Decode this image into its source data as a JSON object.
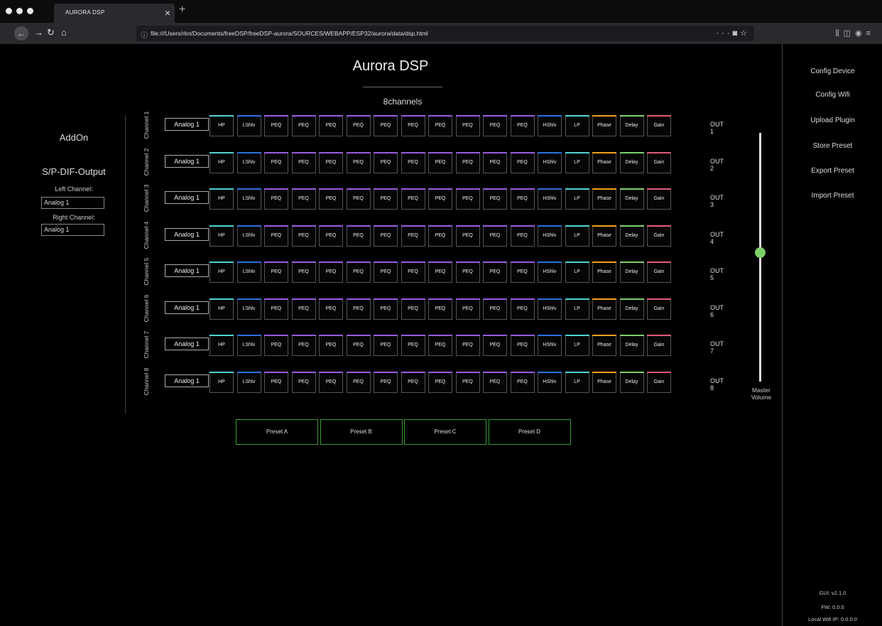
{
  "browser": {
    "tab_title": "AURORA DSP",
    "url": "file:///Users/rkn/Documents/freeDSP/freeDSP-aurora/SOURCES/WEBAPP/ESP32/aurora/data/dsp.html"
  },
  "page": {
    "title": "Aurora DSP",
    "subtitle": "8channels"
  },
  "left_panel": {
    "addon": "AddOn",
    "spdif_title": "S/P-DIF-Output",
    "left_channel_label": "Left Channel:",
    "left_channel_value": "Analog 1",
    "right_channel_label": "Right Channel:",
    "right_channel_value": "Analog 1"
  },
  "blocks": [
    {
      "label": "HP",
      "color": "#4fd3d3"
    },
    {
      "label": "LShlv",
      "color": "#2f6fe0"
    },
    {
      "label": "PEQ",
      "color": "#9a5be0"
    },
    {
      "label": "PEQ",
      "color": "#9a5be0"
    },
    {
      "label": "PEQ",
      "color": "#9a5be0"
    },
    {
      "label": "PEQ",
      "color": "#9a5be0"
    },
    {
      "label": "PEQ",
      "color": "#9a5be0"
    },
    {
      "label": "PEQ",
      "color": "#9a5be0"
    },
    {
      "label": "PEQ",
      "color": "#9a5be0"
    },
    {
      "label": "PEQ",
      "color": "#9a5be0"
    },
    {
      "label": "PEQ",
      "color": "#9a5be0"
    },
    {
      "label": "PEQ",
      "color": "#9a5be0"
    },
    {
      "label": "HShlv",
      "color": "#2f6fe0"
    },
    {
      "label": "LP",
      "color": "#4fd3d3"
    },
    {
      "label": "Phase",
      "color": "#f0a020"
    },
    {
      "label": "Delay",
      "color": "#7ed06b"
    },
    {
      "label": "Gain",
      "color": "#e05a7a"
    }
  ],
  "channels": [
    {
      "label": "Channel 1",
      "input": "Analog 1",
      "output": "OUT 1"
    },
    {
      "label": "Channel 2",
      "input": "Analog 1",
      "output": "OUT 2"
    },
    {
      "label": "Channel 3",
      "input": "Analog 1",
      "output": "OUT 3"
    },
    {
      "label": "Channel 4",
      "input": "Analog 1",
      "output": "OUT 4"
    },
    {
      "label": "Channel 5",
      "input": "Analog 1",
      "output": "OUT 5"
    },
    {
      "label": "Channel 6",
      "input": "Analog 1",
      "output": "OUT 6"
    },
    {
      "label": "Channel 7",
      "input": "Analog 1",
      "output": "OUT 7"
    },
    {
      "label": "Channel 8",
      "input": "Analog 1",
      "output": "OUT 8"
    }
  ],
  "master_volume": {
    "label_line1": "Master",
    "label_line2": "Volume",
    "level": 0.52,
    "thumb_color": "#7ed06b"
  },
  "presets": [
    "Preset A",
    "Preset B",
    "Preset C",
    "Preset D"
  ],
  "right_panel": {
    "items": [
      "Config Device",
      "Config Wifi",
      "Upload Plugin",
      "Store Preset",
      "Export Preset",
      "Import Preset"
    ],
    "gui_version": "GUI: v2.1.0",
    "fw_version": "FW: 0.0.0",
    "wifi_ip": "Local Wifi IP: 0.0.0.0"
  }
}
